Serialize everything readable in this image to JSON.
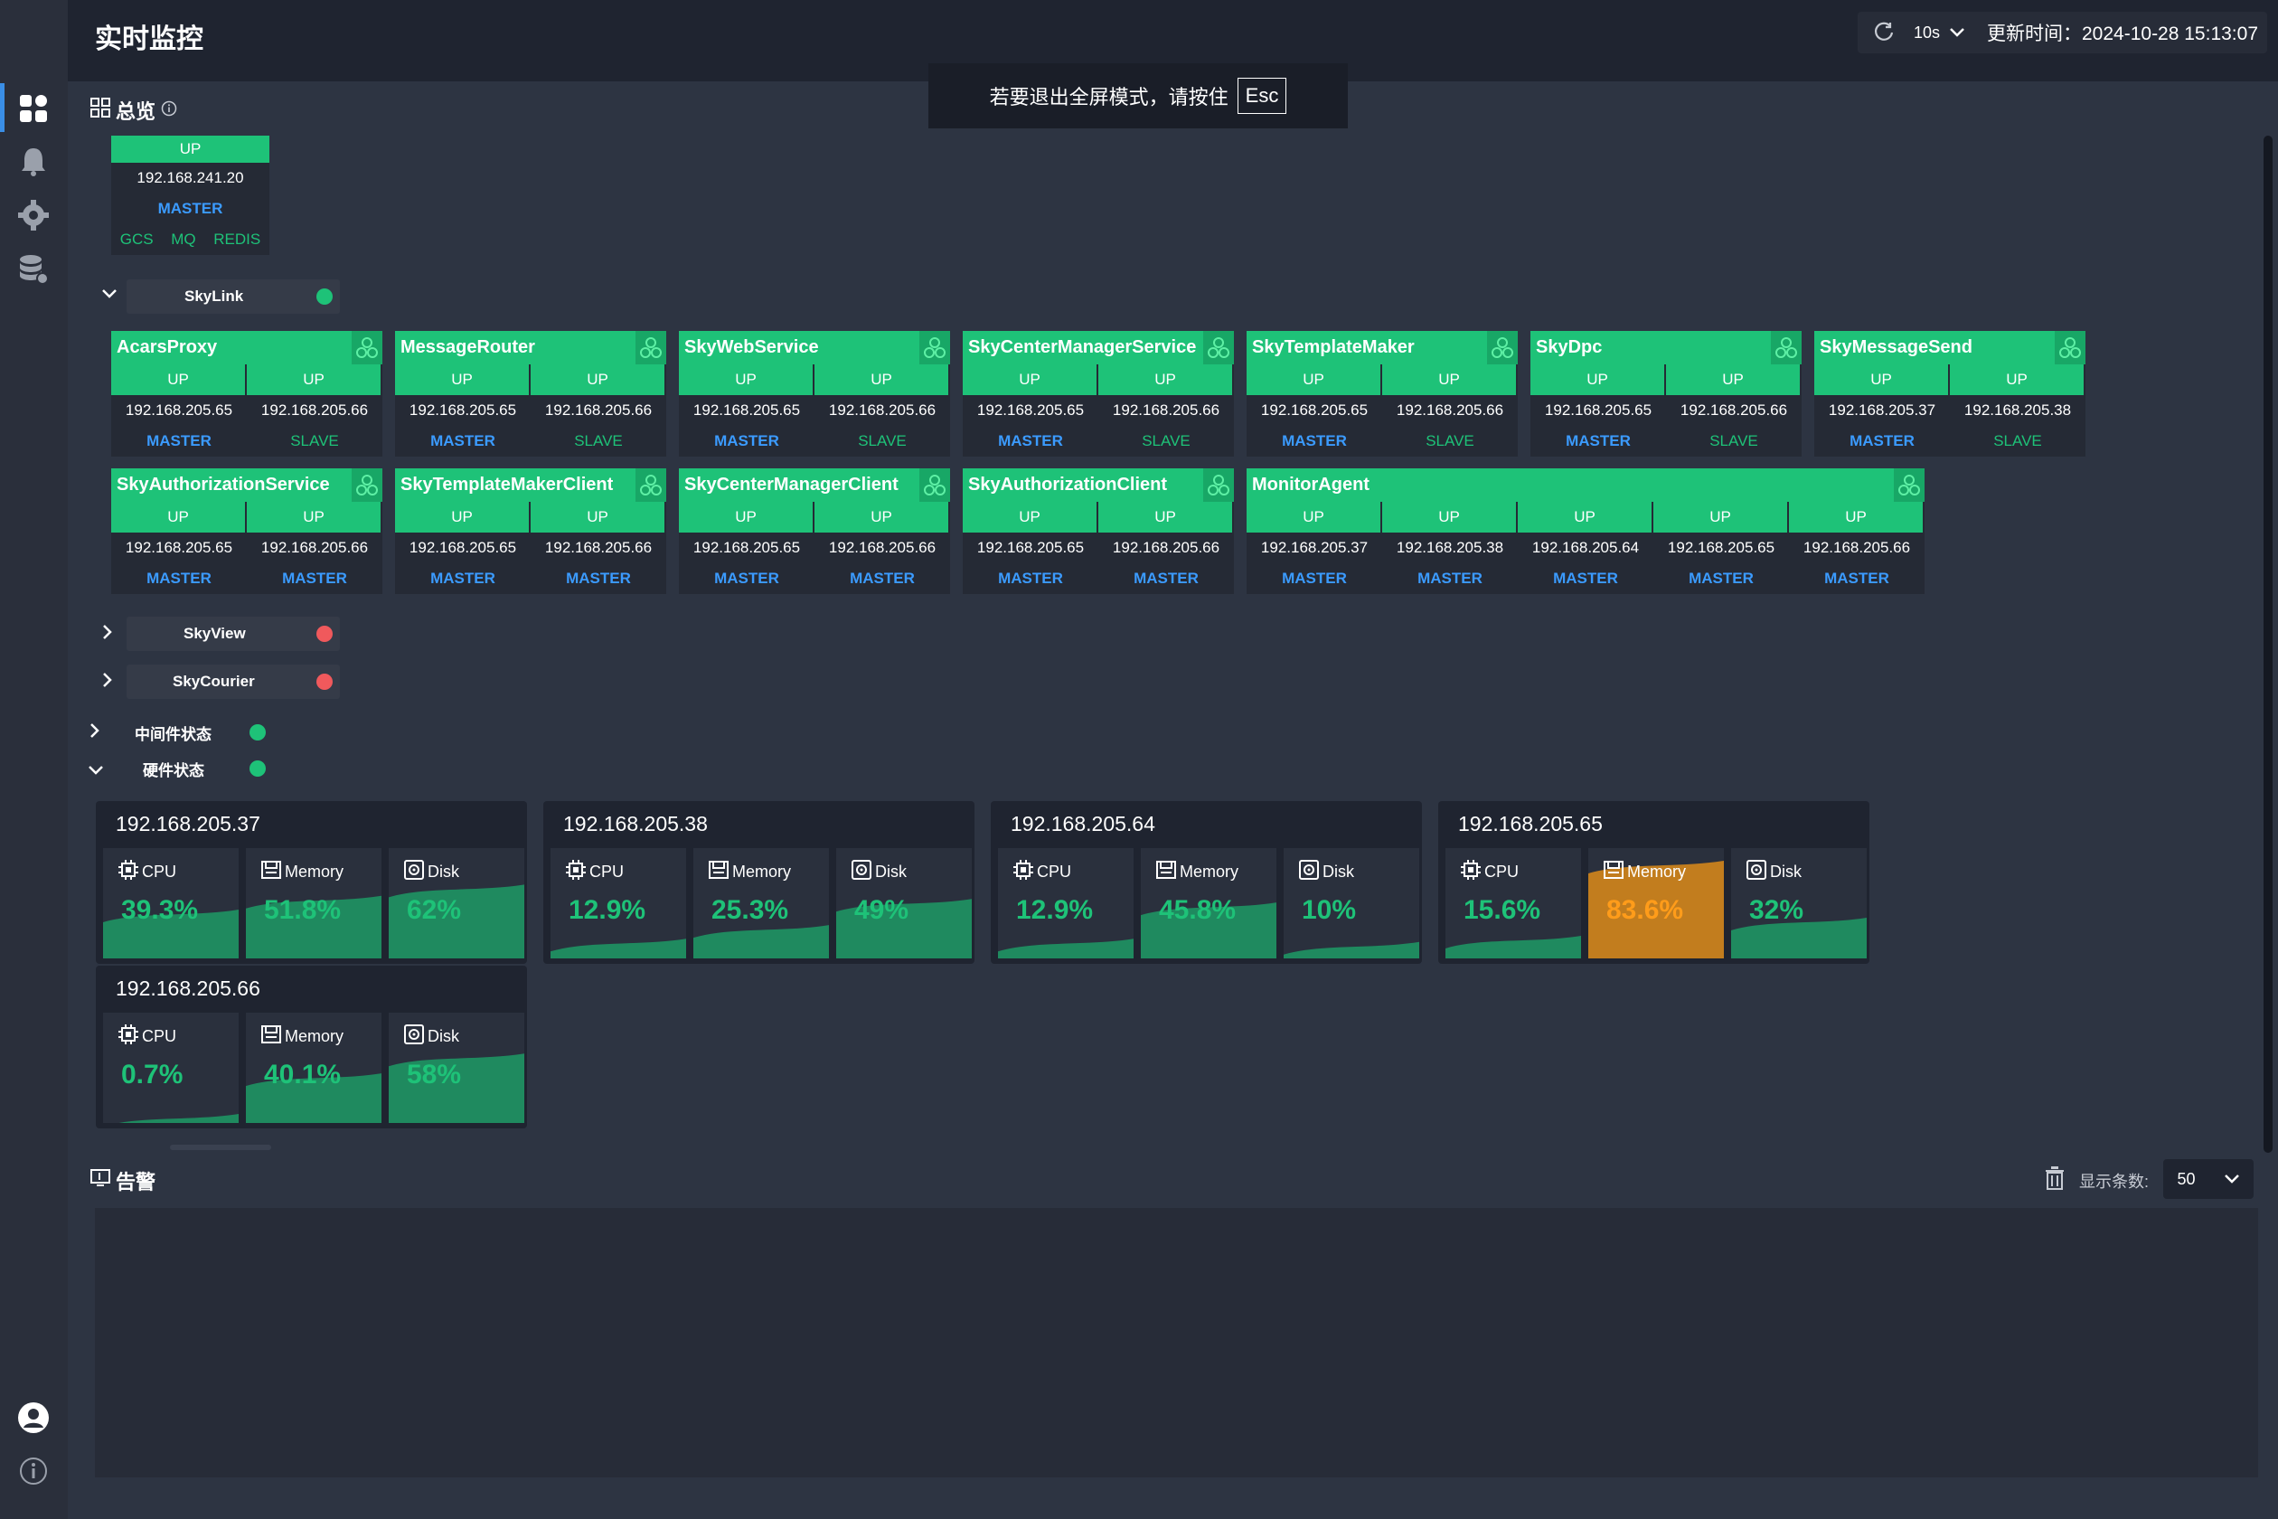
{
  "header": {
    "title": "实时监控",
    "refresh_interval": "10s",
    "update_time": "更新时间：2024-10-28 15:13:07"
  },
  "fullscreen_tip": {
    "text": "若要退出全屏模式，请按住",
    "key": "Esc"
  },
  "overview": {
    "title": "总览",
    "node": {
      "status": "UP",
      "ip": "192.168.241.20",
      "role": "MASTER",
      "links": [
        "GCS",
        "MQ",
        "REDIS"
      ]
    }
  },
  "groups": {
    "skylink": {
      "name": "SkyLink",
      "status": "ok"
    },
    "skyview": {
      "name": "SkyView",
      "status": "error"
    },
    "skycourier": {
      "name": "SkyCourier",
      "status": "error"
    },
    "middleware": {
      "name": "中间件状态",
      "status": "ok"
    },
    "hardware": {
      "name": "硬件状态",
      "status": "ok"
    }
  },
  "services": [
    {
      "name": "AcarsProxy",
      "nodes": [
        {
          "status": "UP",
          "ip": "192.168.205.65",
          "role": "MASTER"
        },
        {
          "status": "UP",
          "ip": "192.168.205.66",
          "role": "SLAVE"
        }
      ]
    },
    {
      "name": "MessageRouter",
      "nodes": [
        {
          "status": "UP",
          "ip": "192.168.205.65",
          "role": "MASTER"
        },
        {
          "status": "UP",
          "ip": "192.168.205.66",
          "role": "SLAVE"
        }
      ]
    },
    {
      "name": "SkyWebService",
      "nodes": [
        {
          "status": "UP",
          "ip": "192.168.205.65",
          "role": "MASTER"
        },
        {
          "status": "UP",
          "ip": "192.168.205.66",
          "role": "SLAVE"
        }
      ]
    },
    {
      "name": "SkyCenterManagerService",
      "nodes": [
        {
          "status": "UP",
          "ip": "192.168.205.65",
          "role": "MASTER"
        },
        {
          "status": "UP",
          "ip": "192.168.205.66",
          "role": "SLAVE"
        }
      ]
    },
    {
      "name": "SkyTemplateMaker",
      "nodes": [
        {
          "status": "UP",
          "ip": "192.168.205.65",
          "role": "MASTER"
        },
        {
          "status": "UP",
          "ip": "192.168.205.66",
          "role": "SLAVE"
        }
      ]
    },
    {
      "name": "SkyDpc",
      "nodes": [
        {
          "status": "UP",
          "ip": "192.168.205.65",
          "role": "MASTER"
        },
        {
          "status": "UP",
          "ip": "192.168.205.66",
          "role": "SLAVE"
        }
      ]
    },
    {
      "name": "SkyMessageSend",
      "nodes": [
        {
          "status": "UP",
          "ip": "192.168.205.37",
          "role": "MASTER"
        },
        {
          "status": "UP",
          "ip": "192.168.205.38",
          "role": "SLAVE"
        }
      ]
    },
    {
      "name": "SkyAuthorizationService",
      "nodes": [
        {
          "status": "UP",
          "ip": "192.168.205.65",
          "role": "MASTER"
        },
        {
          "status": "UP",
          "ip": "192.168.205.66",
          "role": "MASTER"
        }
      ]
    },
    {
      "name": "SkyTemplateMakerClient",
      "nodes": [
        {
          "status": "UP",
          "ip": "192.168.205.65",
          "role": "MASTER"
        },
        {
          "status": "UP",
          "ip": "192.168.205.66",
          "role": "MASTER"
        }
      ]
    },
    {
      "name": "SkyCenterManagerClient",
      "nodes": [
        {
          "status": "UP",
          "ip": "192.168.205.65",
          "role": "MASTER"
        },
        {
          "status": "UP",
          "ip": "192.168.205.66",
          "role": "MASTER"
        }
      ]
    },
    {
      "name": "SkyAuthorizationClient",
      "nodes": [
        {
          "status": "UP",
          "ip": "192.168.205.65",
          "role": "MASTER"
        },
        {
          "status": "UP",
          "ip": "192.168.205.66",
          "role": "MASTER"
        }
      ]
    },
    {
      "name": "MonitorAgent",
      "nodes": [
        {
          "status": "UP",
          "ip": "192.168.205.37",
          "role": "MASTER"
        },
        {
          "status": "UP",
          "ip": "192.168.205.38",
          "role": "MASTER"
        },
        {
          "status": "UP",
          "ip": "192.168.205.64",
          "role": "MASTER"
        },
        {
          "status": "UP",
          "ip": "192.168.205.65",
          "role": "MASTER"
        },
        {
          "status": "UP",
          "ip": "192.168.205.66",
          "role": "MASTER"
        }
      ]
    }
  ],
  "hardware": [
    {
      "ip": "192.168.205.37",
      "cpu": "39.3%",
      "memory": "51.8%",
      "disk": "62%",
      "cpu_level": 0.393,
      "memory_level": 0.518,
      "disk_level": 0.62,
      "memory_warn": false
    },
    {
      "ip": "192.168.205.38",
      "cpu": "12.9%",
      "memory": "25.3%",
      "disk": "49%",
      "cpu_level": 0.129,
      "memory_level": 0.253,
      "disk_level": 0.49,
      "memory_warn": false
    },
    {
      "ip": "192.168.205.64",
      "cpu": "12.9%",
      "memory": "45.8%",
      "disk": "10%",
      "cpu_level": 0.129,
      "memory_level": 0.458,
      "disk_level": 0.1,
      "memory_warn": false
    },
    {
      "ip": "192.168.205.65",
      "cpu": "15.6%",
      "memory": "83.6%",
      "disk": "32%",
      "cpu_level": 0.156,
      "memory_level": 0.836,
      "disk_level": 0.32,
      "memory_warn": true
    },
    {
      "ip": "192.168.205.66",
      "cpu": "0.7%",
      "memory": "40.1%",
      "disk": "58%",
      "cpu_level": 0.007,
      "memory_level": 0.401,
      "disk_level": 0.58,
      "memory_warn": false
    }
  ],
  "metric_labels": {
    "cpu": "CPU",
    "memory": "Memory",
    "disk": "Disk"
  },
  "alarm": {
    "title": "告警",
    "count_label": "显示条数:",
    "count_value": "50"
  },
  "colors": {
    "ok": "#1ec278",
    "error": "#f0595c",
    "master": "#3b9bff",
    "warn": "#c27d1e"
  }
}
